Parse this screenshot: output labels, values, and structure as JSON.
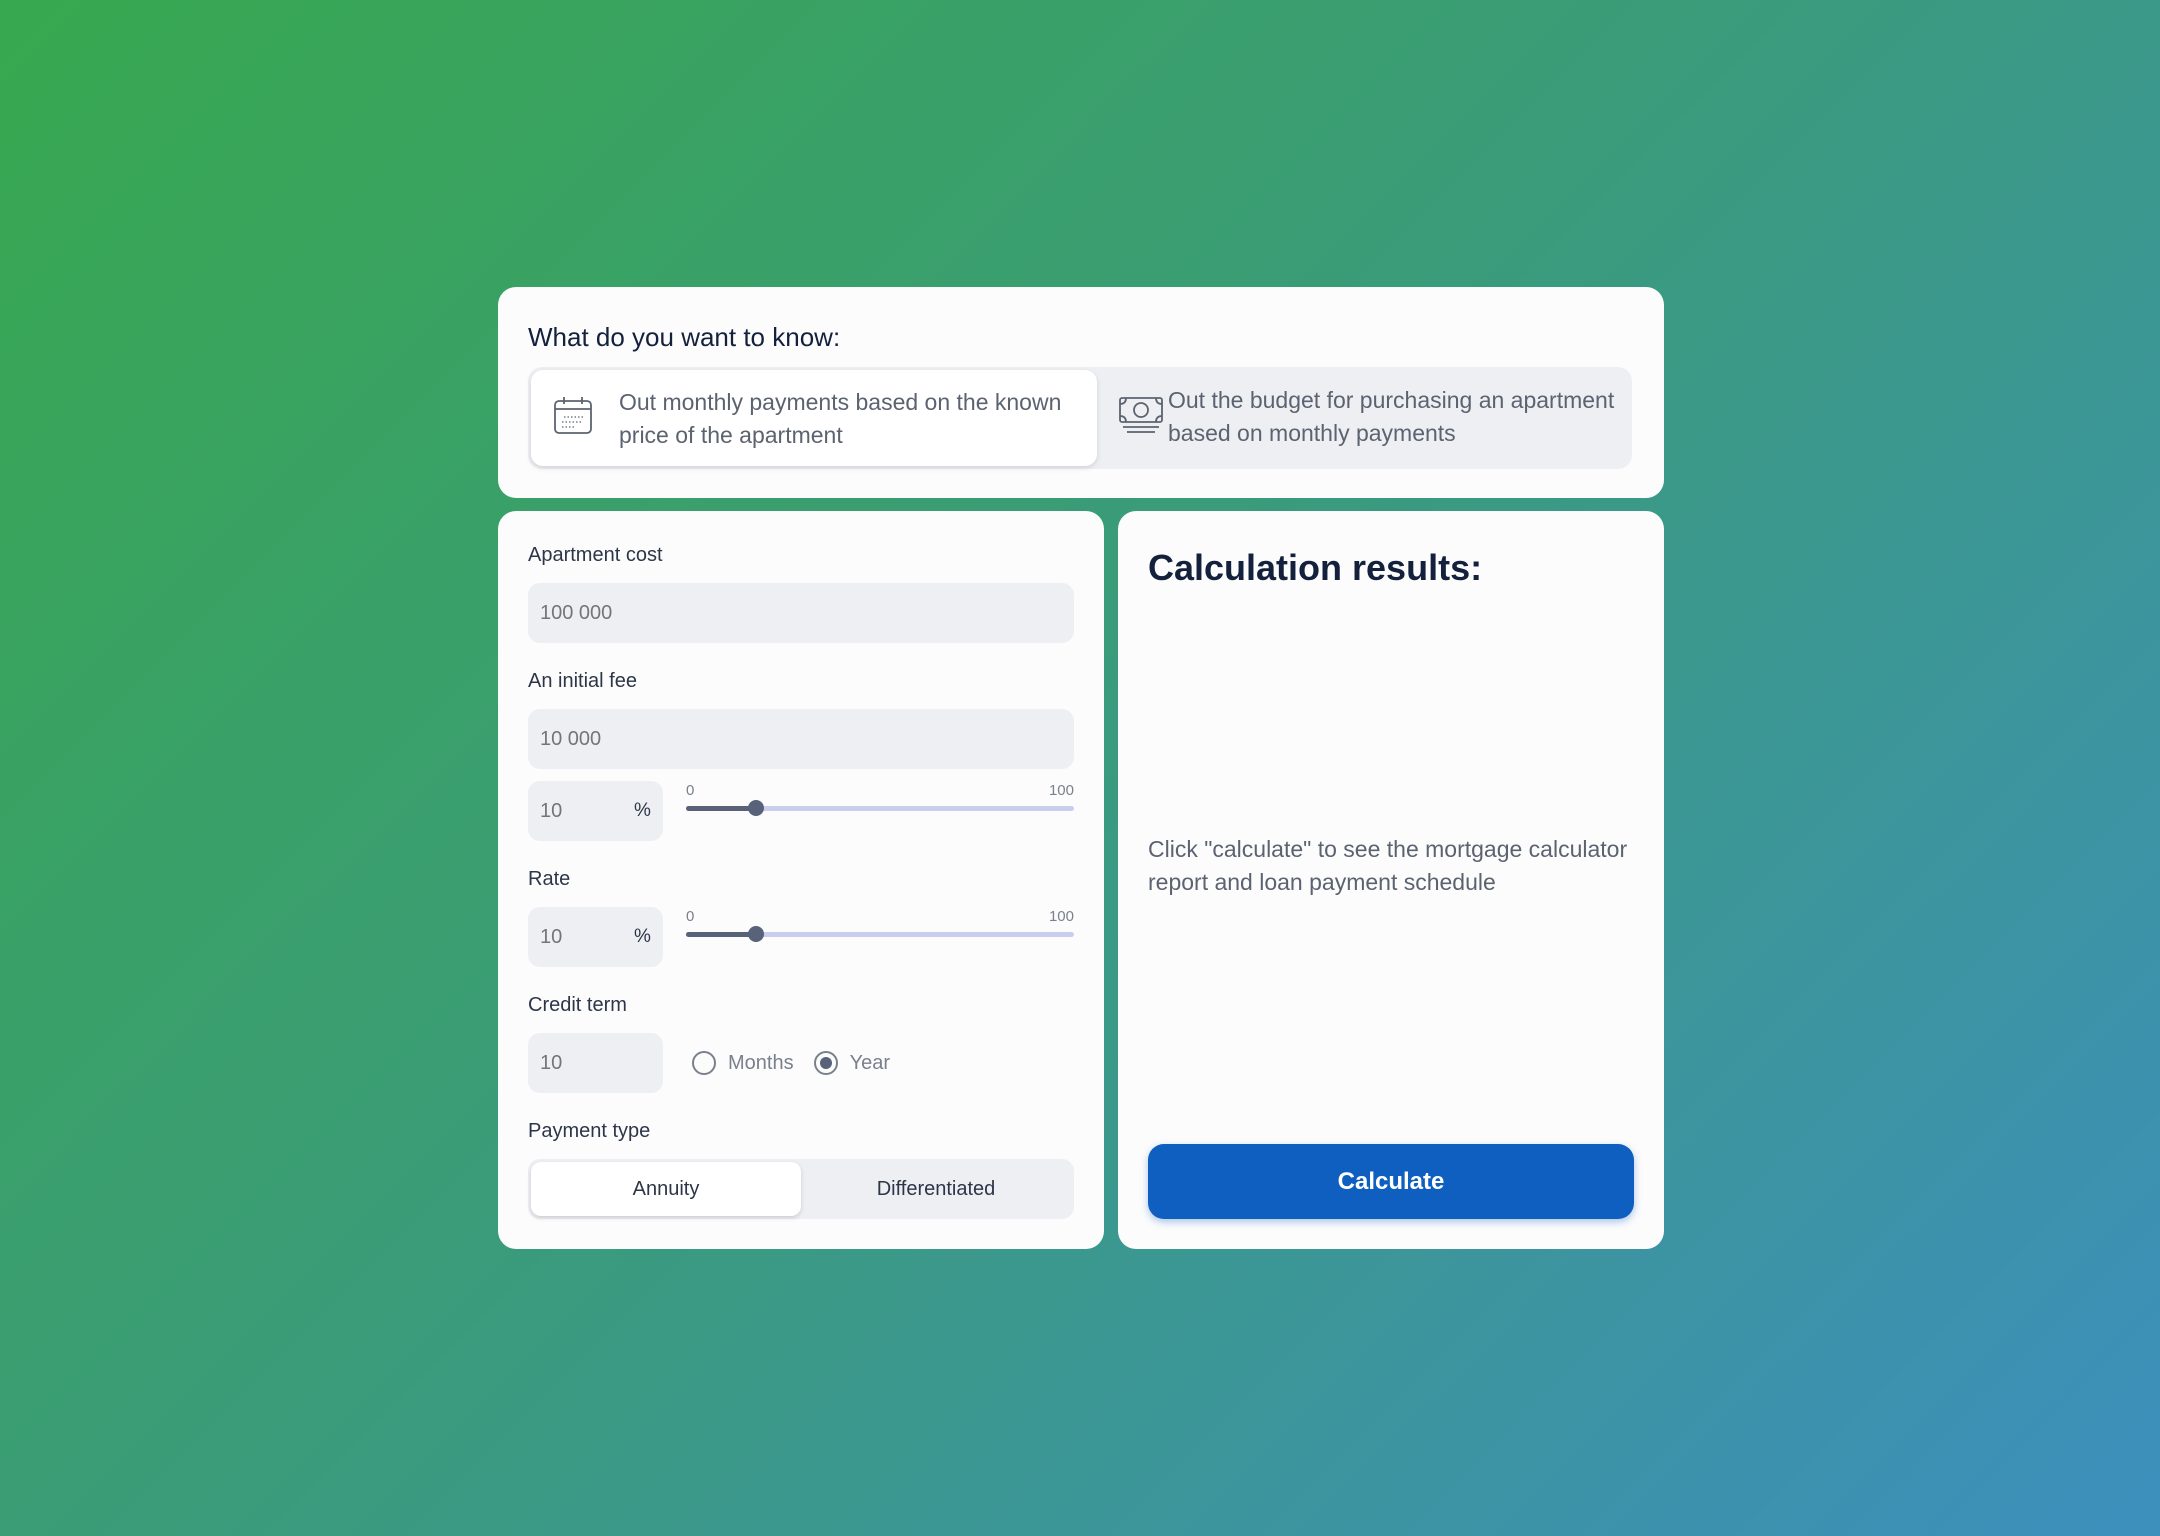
{
  "question": {
    "title": "What do you want to know:",
    "options": [
      {
        "label": "Out monthly payments based on the known price of the apartment",
        "active": true,
        "icon": "calendar-icon"
      },
      {
        "label": "Out the budget for purchasing an apartment based on monthly payments",
        "active": false,
        "icon": "money-icon"
      }
    ]
  },
  "form": {
    "apartment_cost": {
      "label": "Apartment cost",
      "placeholder": "100 000"
    },
    "initial_fee": {
      "label": "An initial fee",
      "placeholder": "10 000",
      "percent_placeholder": "10",
      "percent_sign": "%",
      "slider": {
        "min": "0",
        "max": "100",
        "value": 18
      }
    },
    "rate": {
      "label": "Rate",
      "percent_placeholder": "10",
      "percent_sign": "%",
      "slider": {
        "min": "0",
        "max": "100",
        "value": 18
      }
    },
    "credit_term": {
      "label": "Credit term",
      "placeholder": "10",
      "units": [
        {
          "label": "Months",
          "selected": false
        },
        {
          "label": "Year",
          "selected": true
        }
      ]
    },
    "payment_type": {
      "label": "Payment type",
      "options": [
        {
          "label": "Annuity",
          "selected": true
        },
        {
          "label": "Differentiated",
          "selected": false
        }
      ]
    }
  },
  "results": {
    "title": "Calculation results:",
    "hint": "Click \"calculate\" to see the mortgage calculator report and loan payment schedule",
    "button_label": "Calculate"
  },
  "colors": {
    "accent": "#0f5fc0",
    "slider_fill": "#586278",
    "slider_track": "#c9cdee",
    "input_bg": "#eeeff3"
  }
}
